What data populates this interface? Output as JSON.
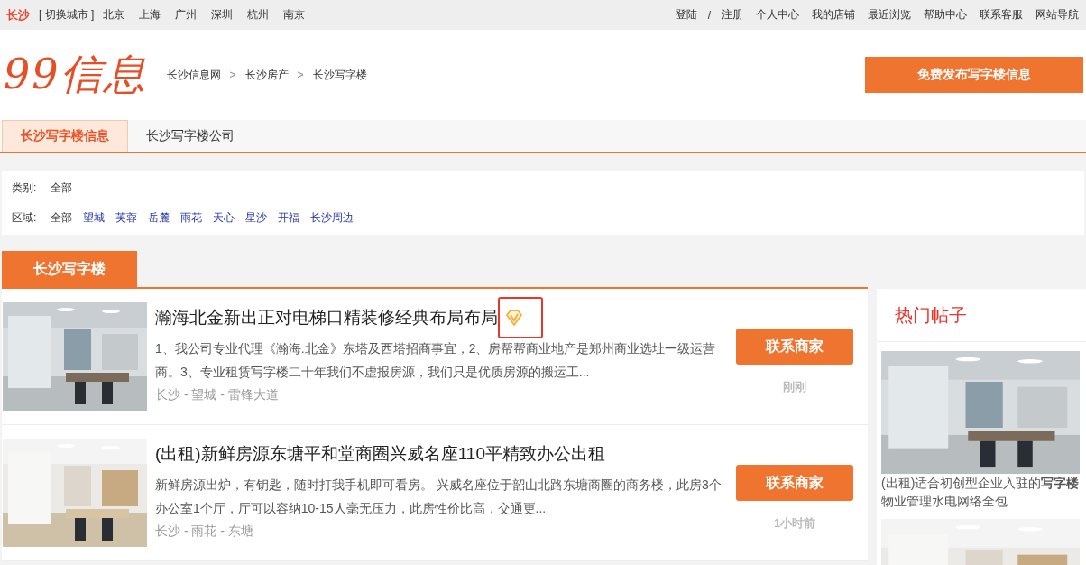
{
  "top_bar": {
    "city": "长沙",
    "switch_city": "[ 切换城市 ]",
    "cities": [
      "北京",
      "上海",
      "广州",
      "深圳",
      "杭州",
      "南京"
    ],
    "login": "登陆",
    "separator": "/",
    "register": "注册",
    "links": [
      "个人中心",
      "我的店铺",
      "最近浏览",
      "帮助中心",
      "联系客服",
      "网站导航"
    ]
  },
  "header": {
    "logo": "99信息",
    "breadcrumb": [
      "长沙信息网",
      "长沙房产",
      "长沙写字楼"
    ],
    "breadcrumb_separator": ">",
    "publish_button": "免费发布写字楼信息"
  },
  "tabs": [
    {
      "label": "长沙写字楼信息",
      "selected": true
    },
    {
      "label": "长沙写字楼公司",
      "selected": false
    }
  ],
  "filters": [
    {
      "label": "类别:",
      "options": [
        {
          "label": "全部",
          "selected": true
        }
      ]
    },
    {
      "label": "区域:",
      "options": [
        {
          "label": "全部",
          "selected": true
        },
        {
          "label": "望城",
          "selected": false
        },
        {
          "label": "芙蓉",
          "selected": false
        },
        {
          "label": "岳麓",
          "selected": false
        },
        {
          "label": "雨花",
          "selected": false
        },
        {
          "label": "天心",
          "selected": false
        },
        {
          "label": "星沙",
          "selected": false
        },
        {
          "label": "开福",
          "selected": false
        },
        {
          "label": "长沙周边",
          "selected": false
        }
      ]
    }
  ],
  "section_title": "长沙写字楼",
  "listings": [
    {
      "title": "瀚海北金新出正对电梯口精装修经典布局布局",
      "vip": true,
      "highlighted": true,
      "description": "1、我公司专业代理《瀚海.北金》东塔及西塔招商事宜，2、房帮帮商业地产是郑州商业选址一级运营商。3、专业租赁写字楼二十年我们不虚报房源，我们只是优质房源的搬运工...",
      "location": [
        "长沙",
        "望城",
        "雷锋大道"
      ],
      "location_separator": "-",
      "button": "联系商家",
      "time": "刚刚"
    },
    {
      "title": "(出租)新鲜房源东塘平和堂商圈兴威名座110平精致办公出租",
      "vip": false,
      "highlighted": false,
      "description": "新鲜房源出炉，有钥匙，随时打我手机即可看房。 兴威名座位于韶山北路东塘商圈的商务楼，此房3个办公室1个厅，厅可以容纳10-15人毫无压力，此房性价比高，交通更...",
      "location": [
        "长沙",
        "雨花",
        "东塘"
      ],
      "location_separator": "-",
      "button": "联系商家",
      "time": "1小时前"
    }
  ],
  "hot_posts": {
    "title": "热门帖子",
    "items": [
      {
        "kind": "picture",
        "text": "(出租)适合初创型企业入驻的**写字楼**物业管理水电网络全包"
      },
      {
        "kind": "picture"
      }
    ]
  }
}
